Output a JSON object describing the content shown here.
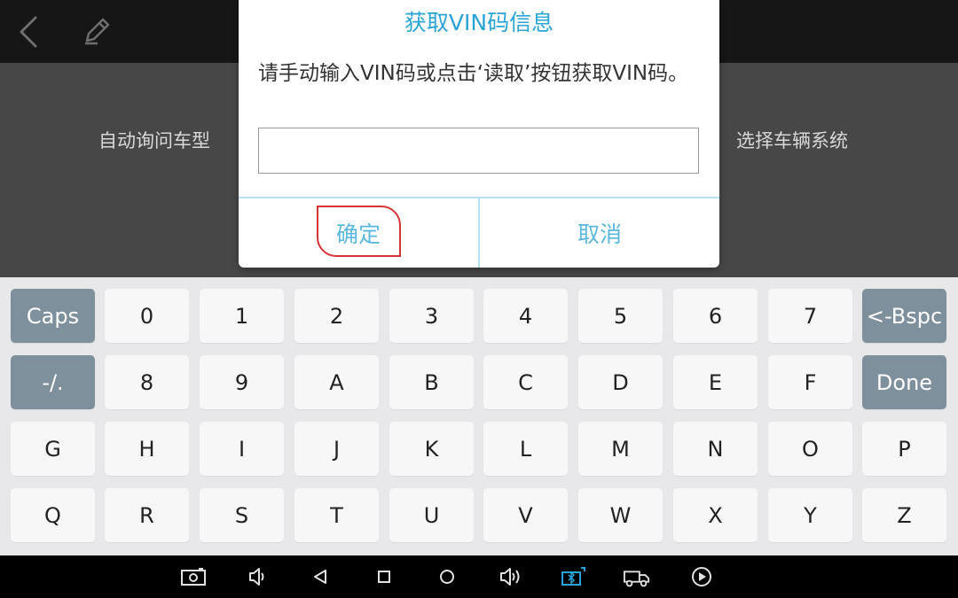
{
  "topbar": {
    "back_icon": "chevron-left-icon",
    "edit_icon": "pencil-icon"
  },
  "menu": {
    "left_label": "自动询问车型",
    "right_label": "选择车辆系统"
  },
  "dialog": {
    "title": "获取VIN码信息",
    "message": "请手动输入VIN码或点击‘读取’按钮获取VIN码。",
    "input_value": "",
    "input_placeholder": "",
    "ok_label": "确定",
    "cancel_label": "取消",
    "title_color": "#2aa4d6",
    "button_color": "#5ab8de",
    "highlight_color": "#d63434"
  },
  "keyboard": {
    "rows": [
      [
        "Caps",
        "0",
        "1",
        "2",
        "3",
        "4",
        "5",
        "6",
        "7",
        "<-Bspc"
      ],
      [
        "-/.",
        "8",
        "9",
        "A",
        "B",
        "C",
        "D",
        "E",
        "F",
        "Done"
      ],
      [
        "G",
        "H",
        "I",
        "J",
        "K",
        "L",
        "M",
        "N",
        "O",
        "P"
      ],
      [
        "Q",
        "R",
        "S",
        "T",
        "U",
        "V",
        "W",
        "X",
        "Y",
        "Z"
      ]
    ],
    "special_color": "#7f909d"
  },
  "navbar": {
    "icons": [
      "screenshot-icon",
      "volume-down-icon",
      "back-icon",
      "recent-apps-icon",
      "home-icon",
      "volume-up-icon",
      "vci-connection-icon",
      "truck-icon",
      "play-icon"
    ],
    "active_color": "#2aa4d6"
  }
}
